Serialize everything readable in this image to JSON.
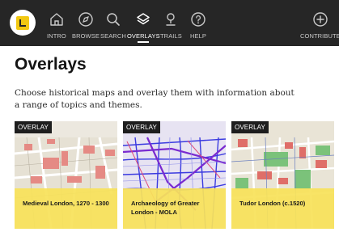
{
  "header": {
    "logo_icon": "location-pin-logo",
    "accent_color": "#f2c811",
    "background_color": "#262626",
    "nav": [
      {
        "id": "intro",
        "label": "INTRO",
        "icon": "home-icon"
      },
      {
        "id": "browse",
        "label": "BROWSE",
        "icon": "compass-icon"
      },
      {
        "id": "search",
        "label": "SEARCH",
        "icon": "search-icon"
      },
      {
        "id": "overlays",
        "label": "OVERLAYS",
        "icon": "layers-icon",
        "active": true
      },
      {
        "id": "trails",
        "label": "TRAILS",
        "icon": "trail-pin-icon"
      },
      {
        "id": "help",
        "label": "HELP",
        "icon": "help-icon"
      }
    ],
    "contribute": {
      "label": "CONTRIBUTE",
      "icon": "plus-circle-icon"
    }
  },
  "page": {
    "title": "Overlays",
    "intro": "Choose historical maps and overlay them with information about a range of topics and themes."
  },
  "cards": [
    {
      "badge": "OVERLAY",
      "title": "Medieval London, 1270 - 1300",
      "map": "street-map-red-blocks"
    },
    {
      "badge": "OVERLAY",
      "title": "Archaeology of Greater London - MOLA",
      "map": "street-map-blue-purple-lines"
    },
    {
      "badge": "OVERLAY",
      "title": "Tudor London (c.1520)",
      "map": "street-map-red-green-areas"
    }
  ]
}
